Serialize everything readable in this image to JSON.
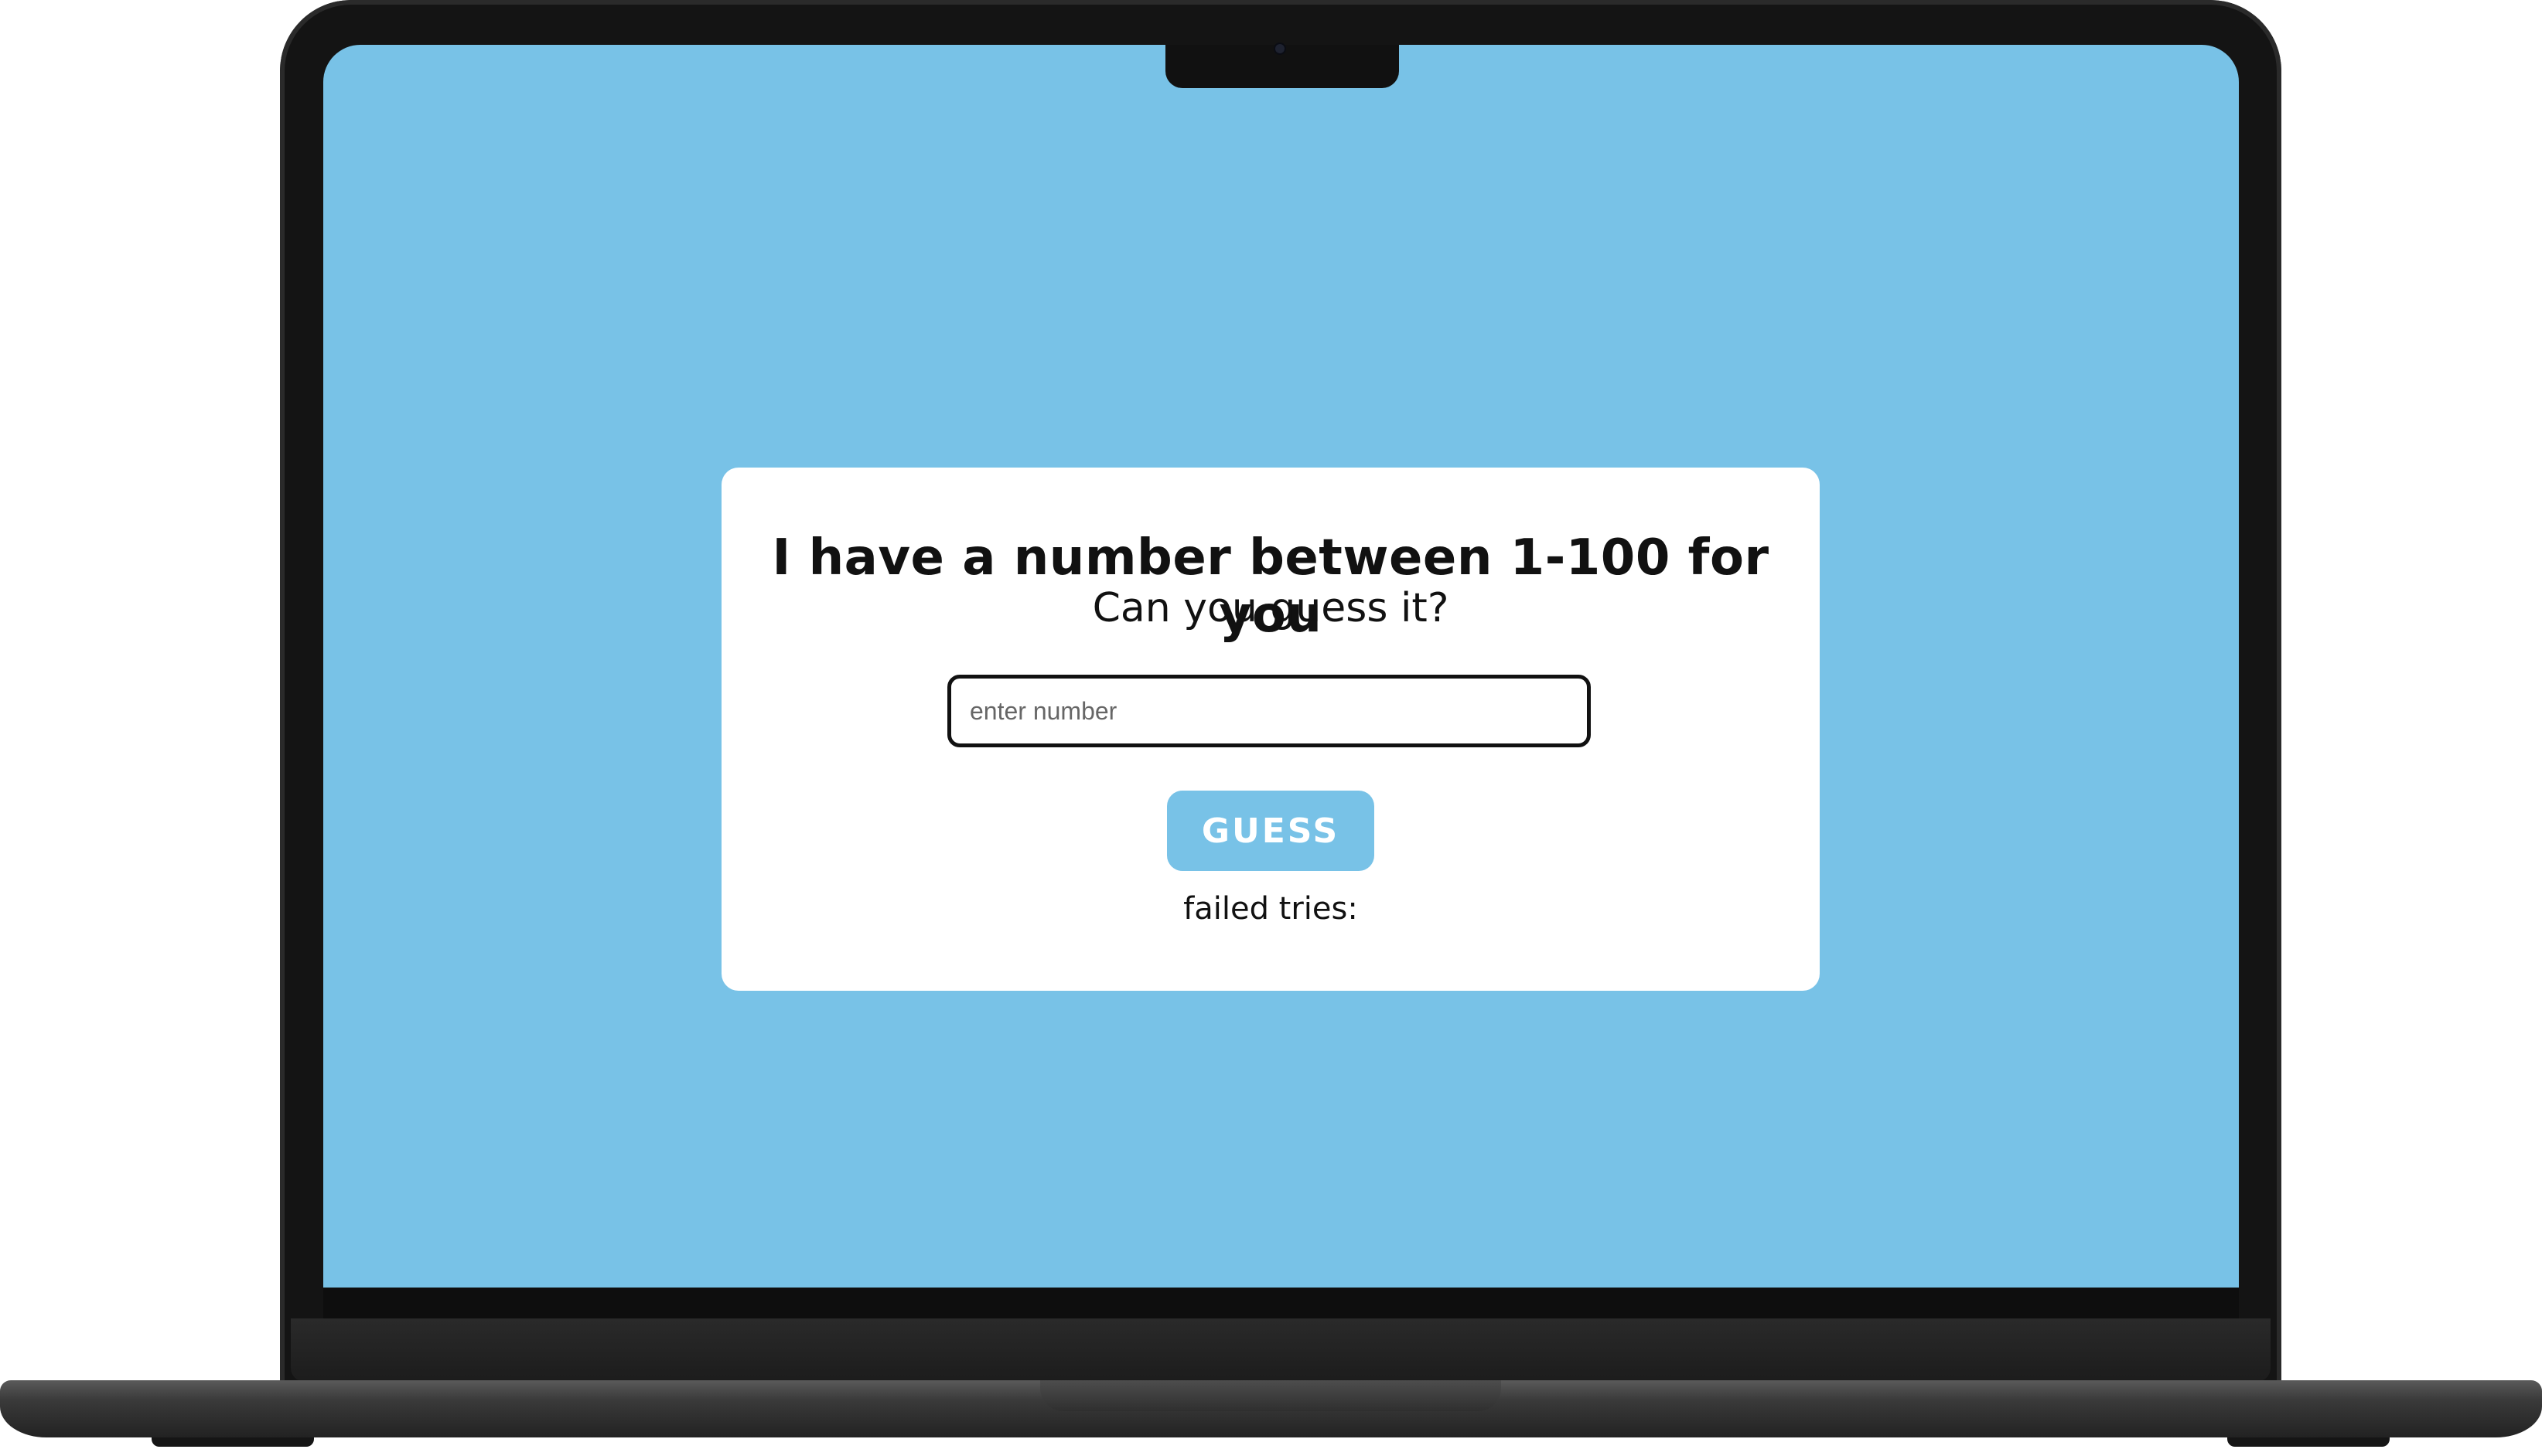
{
  "colors": {
    "screen_background": "#78c2e7",
    "card_background": "#ffffff",
    "button_background": "#78c2e7",
    "button_text": "#ffffff",
    "text": "#111111",
    "laptop_body": "#141414"
  },
  "card": {
    "title": "I have a number between 1-100 for you",
    "subtitle": "Can you guess it?",
    "input": {
      "value": "",
      "placeholder": "enter number"
    },
    "guess_button_label": "GUESS",
    "failed_tries_label": "failed tries:"
  }
}
